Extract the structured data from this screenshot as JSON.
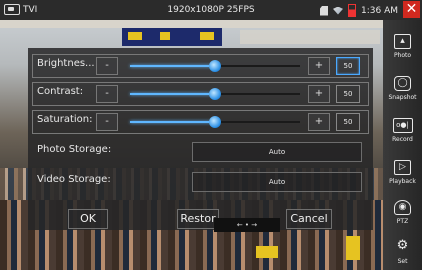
{
  "status_bar": {
    "mode": "TVI",
    "resolution": "1920x1080P 25FPS",
    "time": "1:36 AM"
  },
  "sidebar": {
    "items": [
      {
        "label": "Photo",
        "icon": "photo-icon"
      },
      {
        "label": "Snapshot",
        "icon": "camera-icon"
      },
      {
        "label": "Record",
        "icon": "record-icon"
      },
      {
        "label": "Playback",
        "icon": "playback-icon"
      },
      {
        "label": "PTZ",
        "icon": "ptz-icon"
      },
      {
        "label": "Set",
        "icon": "gear-icon"
      }
    ]
  },
  "dialog": {
    "sliders": [
      {
        "label": "Brightnes...",
        "value": "50",
        "level": 0.5,
        "minus": "-",
        "plus": "+"
      },
      {
        "label": "Contrast:",
        "value": "50",
        "level": 0.5,
        "minus": "-",
        "plus": "+"
      },
      {
        "label": "Saturation:",
        "value": "50",
        "level": 0.5,
        "minus": "-",
        "plus": "+"
      }
    ],
    "photo_storage": {
      "label": "Photo Storage:",
      "value": "Auto"
    },
    "video_storage": {
      "label": "Video Storage:",
      "value": "Auto"
    },
    "buttons": {
      "ok": "OK",
      "restore": "Restor",
      "cancel": "Cancel"
    },
    "pager": "← • →"
  },
  "colors": {
    "accent": "#4aa9ff",
    "close": "#d0291f"
  }
}
